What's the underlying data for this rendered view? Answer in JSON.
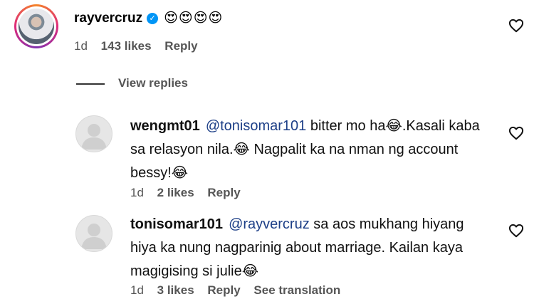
{
  "main_comment": {
    "username": "rayvercruz",
    "emojis": "😍😍😍😍",
    "time": "1d",
    "likes": "143 likes",
    "reply": "Reply"
  },
  "view_replies": "View replies",
  "replies": [
    {
      "username": "wengmt01",
      "mention": "@tonisomar101",
      "text": " bitter mo ha😂.Kasali kaba sa relasyon nila.😂 Nagpalit ka na nman ng account bessy!😂",
      "time": "1d",
      "likes": "2 likes",
      "reply": "Reply"
    },
    {
      "username": "tonisomar101",
      "mention": "@rayvercruz",
      "text": " sa aos mukhang hiyang hiya ka nung nagparinig about marriage. Kailan kaya magigising si julie😂",
      "time": "1d",
      "likes": "3 likes",
      "reply": "Reply",
      "see_translation": "See translation"
    }
  ]
}
